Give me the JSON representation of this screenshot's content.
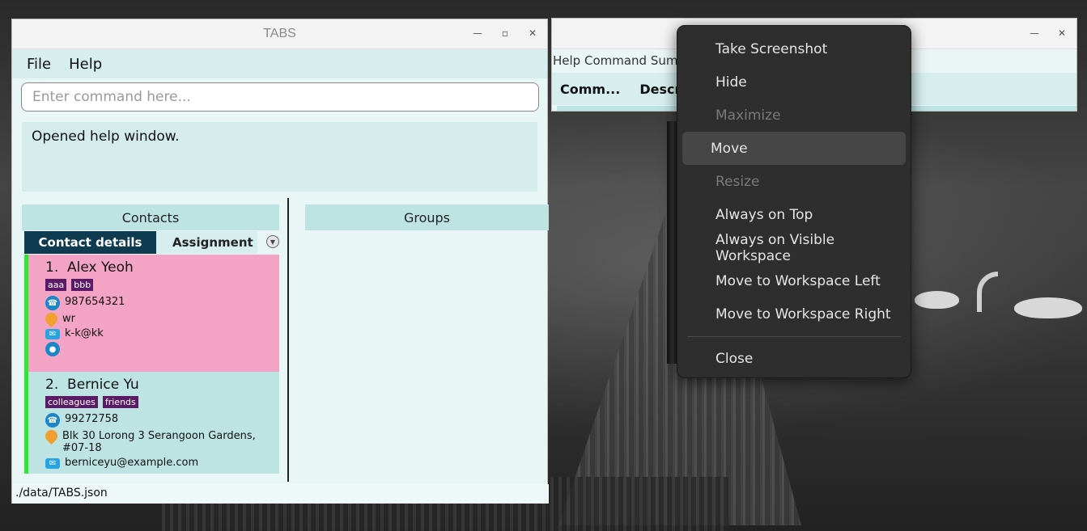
{
  "tabs_window": {
    "title": "TABS",
    "menu": [
      "File",
      "Help"
    ],
    "command_placeholder": "Enter command here...",
    "result_text": "Opened help window.",
    "contacts_header": "Contacts",
    "groups_header": "Groups",
    "tabs": [
      "Contact details",
      "Assignment"
    ],
    "contacts": [
      {
        "index": "1.",
        "name": "Alex Yeoh",
        "tags": [
          "aaa",
          "bbb"
        ],
        "phone": "987654321",
        "address": "wr",
        "email": "k-k@kk"
      },
      {
        "index": "2.",
        "name": "Bernice Yu",
        "tags": [
          "colleagues",
          "friends"
        ],
        "phone": "99272758",
        "address": "Blk 30 Lorong 3 Serangoon Gardens, #07-18",
        "email": "berniceyu@example.com"
      }
    ],
    "status_path": "./data/TABS.json"
  },
  "help_window": {
    "subtitle": "Help Command Summ",
    "columns": [
      "Comm...",
      "Descr"
    ]
  },
  "context_menu": {
    "items": [
      {
        "label": "Take Screenshot",
        "enabled": true
      },
      {
        "label": "Hide",
        "enabled": true
      },
      {
        "label": "Maximize",
        "enabled": false
      },
      {
        "label": "Move",
        "enabled": true,
        "highlighted": true
      },
      {
        "label": "Resize",
        "enabled": false
      },
      {
        "label": "Always on Top",
        "enabled": true
      },
      {
        "label": "Always on Visible Workspace",
        "enabled": true
      },
      {
        "label": "Move to Workspace Left",
        "enabled": true
      },
      {
        "label": "Move to Workspace Right",
        "enabled": true
      }
    ],
    "close_label": "Close"
  },
  "colors": {
    "card_pink": "#f3a3c4",
    "card_teal": "#bde3e3",
    "tag_purple": "#5b1a66",
    "active_tab": "#0f3b50",
    "selection_bar": "#2ee82e"
  }
}
